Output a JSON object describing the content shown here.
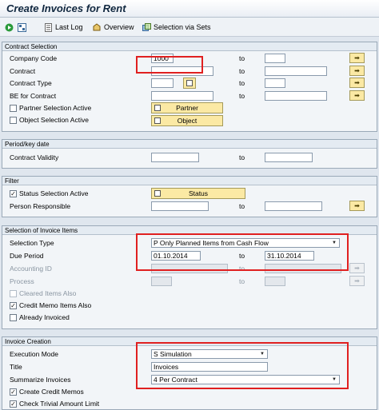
{
  "title": "Create Invoices for Rent",
  "toolbar": {
    "last_log": "Last Log",
    "overview": "Overview",
    "selection_via_sets": "Selection via Sets"
  },
  "contract_selection": {
    "header": "Contract Selection",
    "company_code": "Company Code",
    "company_code_value": "1000",
    "contract": "Contract",
    "contract_type": "Contract Type",
    "be_for_contract": "BE for Contract",
    "partner_selection_active": "Partner Selection Active",
    "object_selection_active": "Object Selection Active",
    "partner_button": "Partner",
    "object_button": "Object",
    "to": "to"
  },
  "period": {
    "header": "Period/key date",
    "contract_validity": "Contract Validity",
    "to": "to"
  },
  "filter": {
    "header": "Filter",
    "status_selection_active": "Status Selection Active",
    "status_button": "Status",
    "person_responsible": "Person Responsible",
    "to": "to"
  },
  "items": {
    "header": "Selection of Invoice Items",
    "selection_type": "Selection Type",
    "selection_type_value": "P Only Planned Items from Cash Flow",
    "due_period": "Due Period",
    "due_from": "01.10.2014",
    "due_to": "31.10.2014",
    "accounting_id": "Accounting ID",
    "process": "Process",
    "cleared_items_also": "Cleared Items Also",
    "credit_memo_items_also": "Credit Memo Items Also",
    "already_invoiced": "Already Invoiced",
    "to": "to"
  },
  "creation": {
    "header": "Invoice Creation",
    "execution_mode": "Execution Mode",
    "execution_mode_value": "S Simulation",
    "title_label": "Title",
    "title_value": "Invoices",
    "summarize_invoices": "Summarize Invoices",
    "summarize_value": "4 Per Contract",
    "create_credit_memos": "Create Credit Memos",
    "check_trivial_amount_limit": "Check Trivial Amount Limit"
  },
  "colors": {
    "highlight": "#e02020",
    "button": "#fbe9a4"
  },
  "icons": [
    "execute-icon",
    "variant-icon",
    "last-log-icon",
    "overview-icon",
    "selection-sets-icon",
    "multiple-selection-icon"
  ]
}
